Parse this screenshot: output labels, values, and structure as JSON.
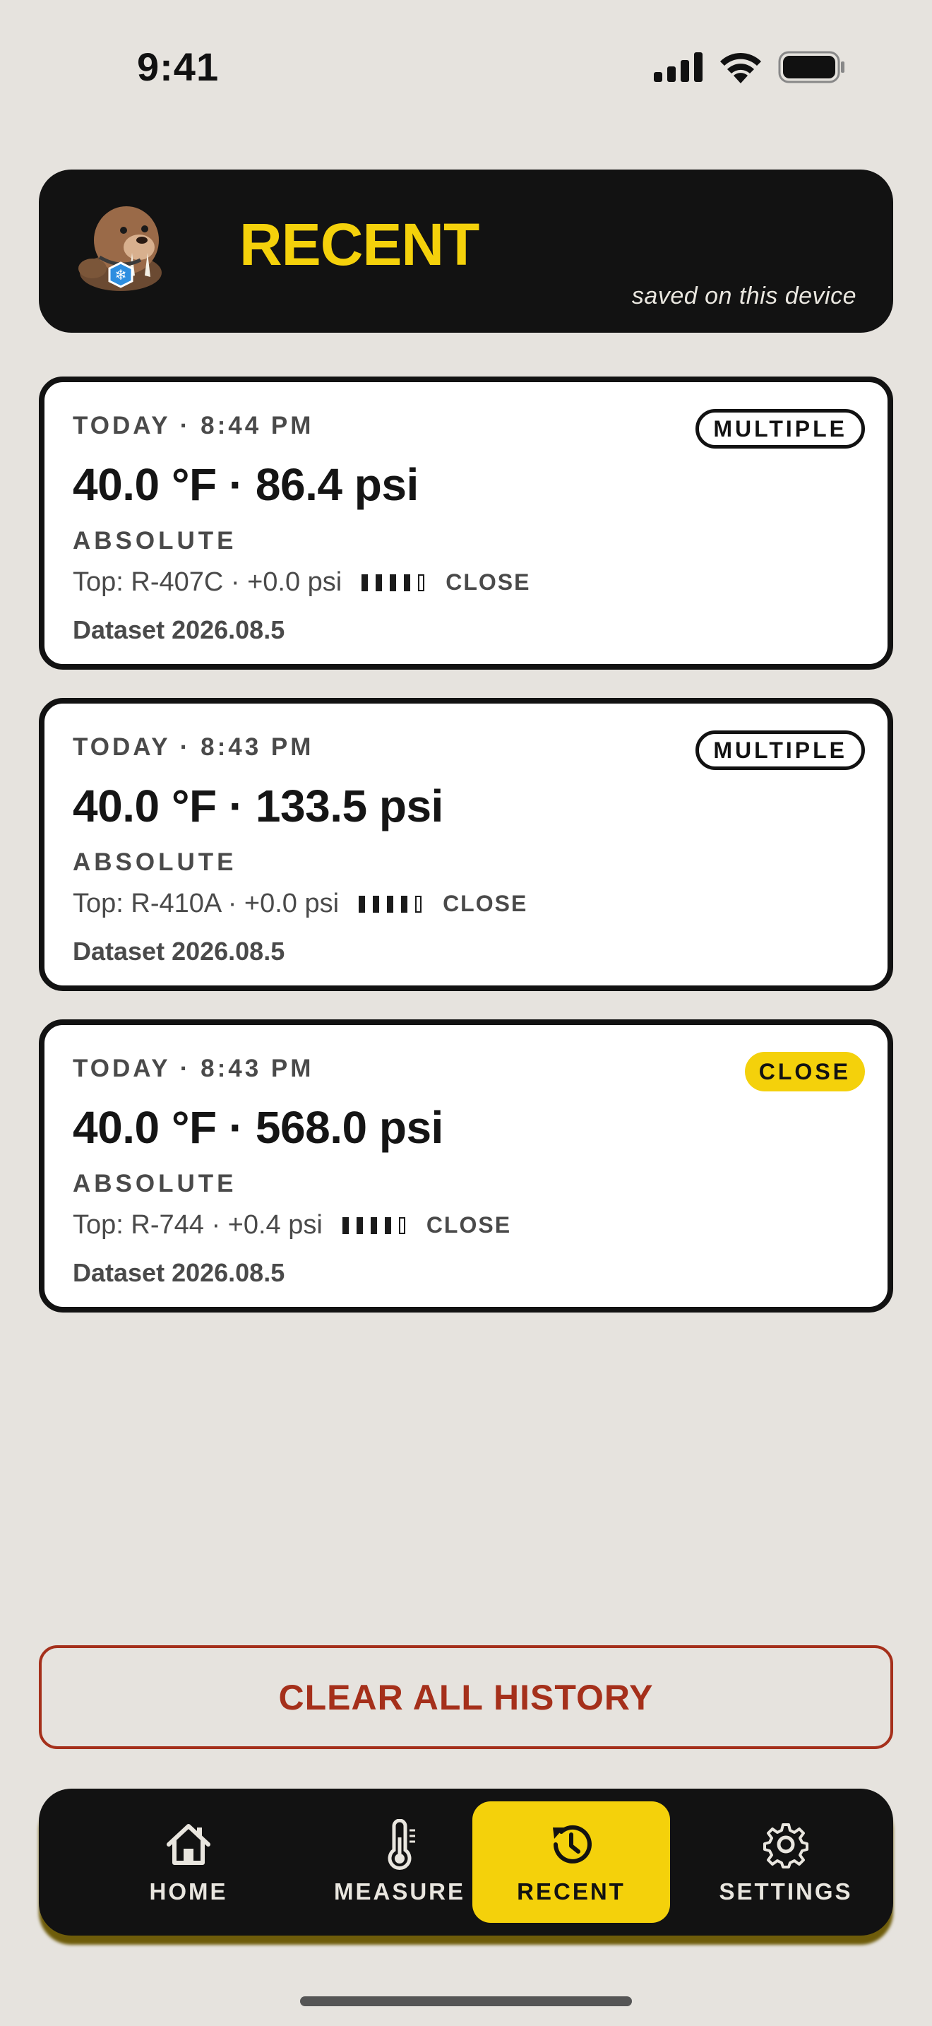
{
  "status_bar": {
    "time": "9:41"
  },
  "header": {
    "title": "RECENT",
    "subtitle": "saved on this device",
    "accent_color": "#f4d10b"
  },
  "history": [
    {
      "time": "TODAY · 8:44 PM",
      "badge": "MULTIPLE",
      "badge_style": "outline",
      "reading": "40.0 °F · 86.4 psi",
      "mode": "ABSOLUTE",
      "top_match": "Top: R-407C · +0.0 psi",
      "confidence_level": 4,
      "confidence_max": 5,
      "confidence_label": "CLOSE",
      "dataset": "Dataset 2026.08.5"
    },
    {
      "time": "TODAY · 8:43 PM",
      "badge": "MULTIPLE",
      "badge_style": "outline",
      "reading": "40.0 °F · 133.5 psi",
      "mode": "ABSOLUTE",
      "top_match": "Top: R-410A · +0.0 psi",
      "confidence_level": 4,
      "confidence_max": 5,
      "confidence_label": "CLOSE",
      "dataset": "Dataset 2026.08.5"
    },
    {
      "time": "TODAY · 8:43 PM",
      "badge": "CLOSE",
      "badge_style": "filled",
      "reading": "40.0 °F · 568.0 psi",
      "mode": "ABSOLUTE",
      "top_match": "Top: R-744 · +0.4 psi",
      "confidence_level": 4,
      "confidence_max": 5,
      "confidence_label": "CLOSE",
      "dataset": "Dataset 2026.08.5"
    }
  ],
  "clear_button": {
    "label": "CLEAR ALL HISTORY",
    "color": "#a5301b"
  },
  "tabs": [
    {
      "label": "HOME",
      "icon": "home-icon",
      "active": false
    },
    {
      "label": "MEASURE",
      "icon": "thermometer-icon",
      "active": false
    },
    {
      "label": "RECENT",
      "icon": "history-icon",
      "active": true
    },
    {
      "label": "SETTINGS",
      "icon": "gear-icon",
      "active": false
    }
  ]
}
